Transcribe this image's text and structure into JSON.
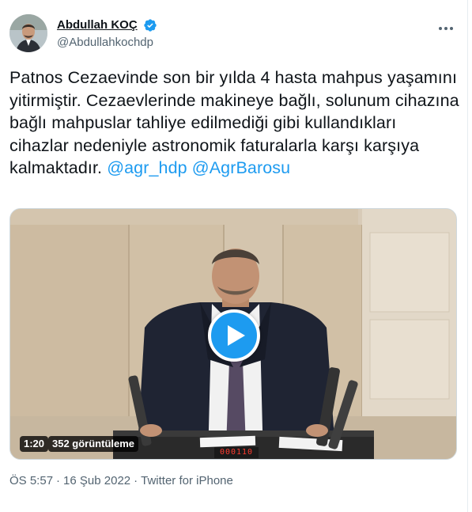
{
  "author": {
    "display_name": "Abdullah KOÇ",
    "handle": "@Abdullahkochdp",
    "verified": true
  },
  "tweet": {
    "text_before": "Patnos Cezaevinde son bir yılda 4 hasta mahpus yaşamını yitirmiştir. Cezaevlerinde makineye bağlı, solunum cihazına bağlı mahpuslar tahliye edilmediği gibi kullandıkları cihazlar nedeniyle astronomik faturalarla karşı karşıya kalmaktadır.",
    "mention_1": "@agr_hdp",
    "mention_2": "@AgrBarosu"
  },
  "video": {
    "duration": "1:20",
    "views": "352 görüntüleme",
    "timer_readout": "000110"
  },
  "meta": {
    "time": "ÖS 5:57",
    "separator": "·",
    "date": "16 Şub 2022",
    "client": "Twitter for iPhone"
  },
  "colors": {
    "accent": "#1d9bf0",
    "text": "#0f1419",
    "secondary": "#536471"
  },
  "icons": {
    "verified": "verified-badge-icon",
    "more": "more-options-icon",
    "play": "play-icon"
  }
}
